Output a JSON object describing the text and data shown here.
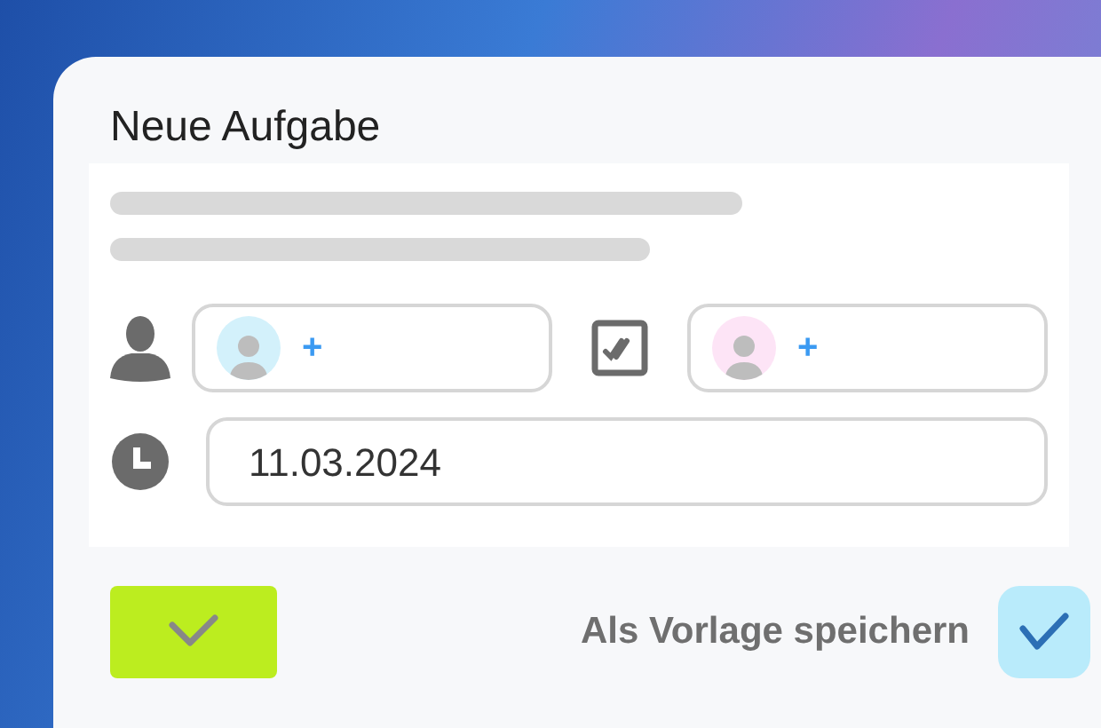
{
  "title": "Neue Aufgabe",
  "assignees": [
    {
      "add_label": "+",
      "color": "#d3f1fb"
    },
    {
      "add_label": "+",
      "color": "#fde4f6"
    }
  ],
  "date": {
    "value": "11.03.2024"
  },
  "save_as_template": {
    "label": "Als Vorlage speichern",
    "checked": true
  }
}
